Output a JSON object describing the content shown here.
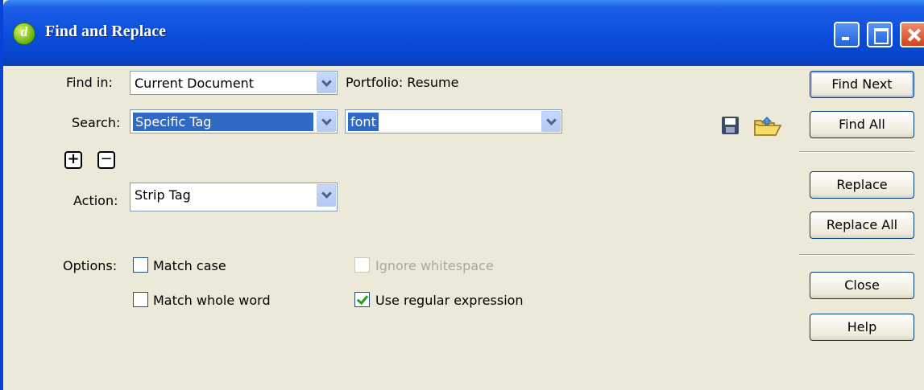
{
  "window": {
    "title": "Find and Replace",
    "app_icon_glyph": "d"
  },
  "find_in": {
    "label": "Find in:",
    "value": "Current Document",
    "info": "Portfolio: Resume"
  },
  "search": {
    "label": "Search:",
    "type_value": "Specific Tag",
    "tag_value": "font"
  },
  "action": {
    "label": "Action:",
    "value": "Strip Tag"
  },
  "add_remove": {
    "add_glyph": "+",
    "remove_glyph": "−"
  },
  "options": {
    "label": "Options:",
    "match_case": {
      "label": "Match case",
      "checked": false
    },
    "match_whole_word": {
      "label": "Match whole word",
      "checked": false
    },
    "ignore_whitespace": {
      "label": "Ignore whitespace",
      "checked": false,
      "disabled": true
    },
    "use_regex": {
      "label": "Use regular expression",
      "checked": true
    }
  },
  "buttons": {
    "find_next": "Find Next",
    "find_all": "Find All",
    "replace": "Replace",
    "replace_all": "Replace All",
    "close": "Close",
    "help": "Help"
  },
  "colors": {
    "titlebar": "#0a4ddb",
    "dialog_bg": "#ece9d8",
    "selection": "#316ac5",
    "check_mark": "#21a121"
  },
  "icons": [
    "app-icon",
    "minimize-icon",
    "maximize-icon",
    "close-icon",
    "save-query-icon",
    "load-query-icon",
    "add-icon",
    "remove-icon",
    "dropdown-arrow-icon"
  ]
}
